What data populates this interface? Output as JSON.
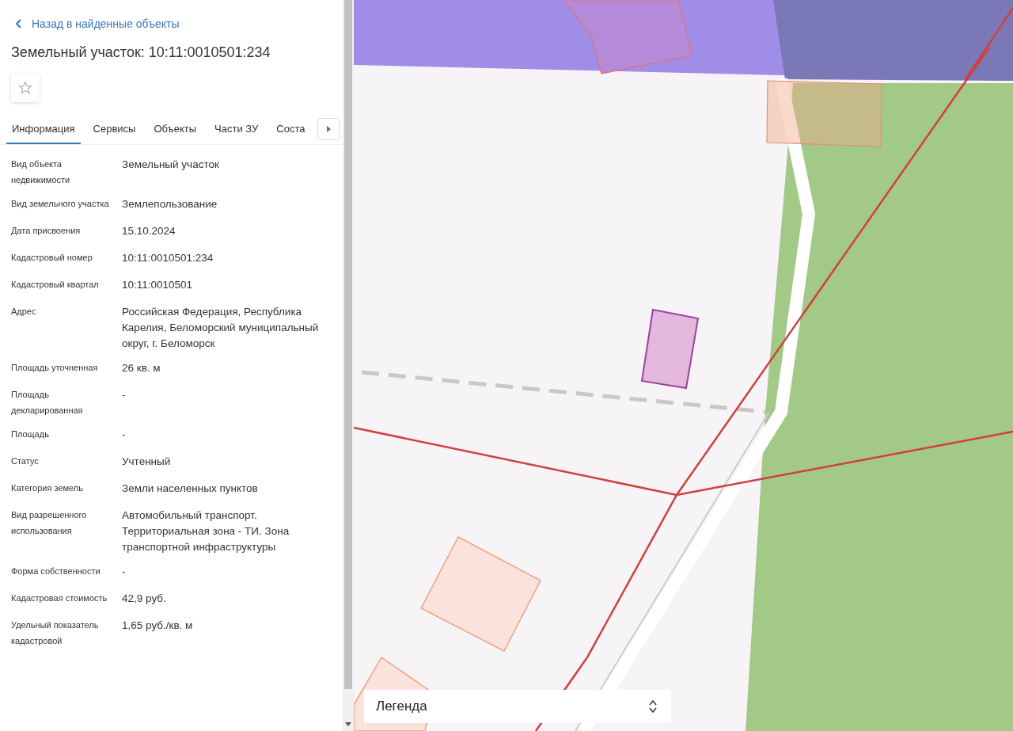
{
  "back_link": "Назад в найденные объекты",
  "title": "Земельный участок: 10:11:0010501:234",
  "favorite": {
    "on": false
  },
  "tabs": [
    {
      "label": "Информация",
      "selected": true
    },
    {
      "label": "Сервисы",
      "selected": false
    },
    {
      "label": "Объекты",
      "selected": false
    },
    {
      "label": "Части ЗУ",
      "selected": false
    },
    {
      "label": "Соста",
      "selected": false
    }
  ],
  "properties": [
    {
      "label": "Вид объекта недвижимости",
      "value": "Земельный участок"
    },
    {
      "label": "Вид земельного участка",
      "value": "Землепользование"
    },
    {
      "label": "Дата присвоения",
      "value": "15.10.2024"
    },
    {
      "label": "Кадастровый номер",
      "value": "10:11:0010501:234"
    },
    {
      "label": "Кадастровый квартал",
      "value": "10:11:0010501"
    },
    {
      "label": "Адрес",
      "value": "Российская Федерация, Республика Карелия, Беломорский муниципальный округ, г. Беломорск"
    },
    {
      "label": "Площадь уточненная",
      "value": "26 кв. м"
    },
    {
      "label": "Площадь декларированная",
      "value": "-"
    },
    {
      "label": "Площадь",
      "value": "-"
    },
    {
      "label": "Статус",
      "value": "Учтенный"
    },
    {
      "label": "Категория земель",
      "value": "Земли населенных пунктов"
    },
    {
      "label": "Вид разрешенного использования",
      "value": "Автомобильный транспорт. Территориальная зона - ТИ. Зона транспортной инфраструктуры"
    },
    {
      "label": "Форма собственности",
      "value": "-"
    },
    {
      "label": "Кадастровая стоимость",
      "value": "42,9 руб."
    },
    {
      "label": "Удельный показатель кадастровой",
      "value": "1,65 руб./кв. м"
    }
  ],
  "legend": {
    "label": "Легенда",
    "expanded": false
  }
}
